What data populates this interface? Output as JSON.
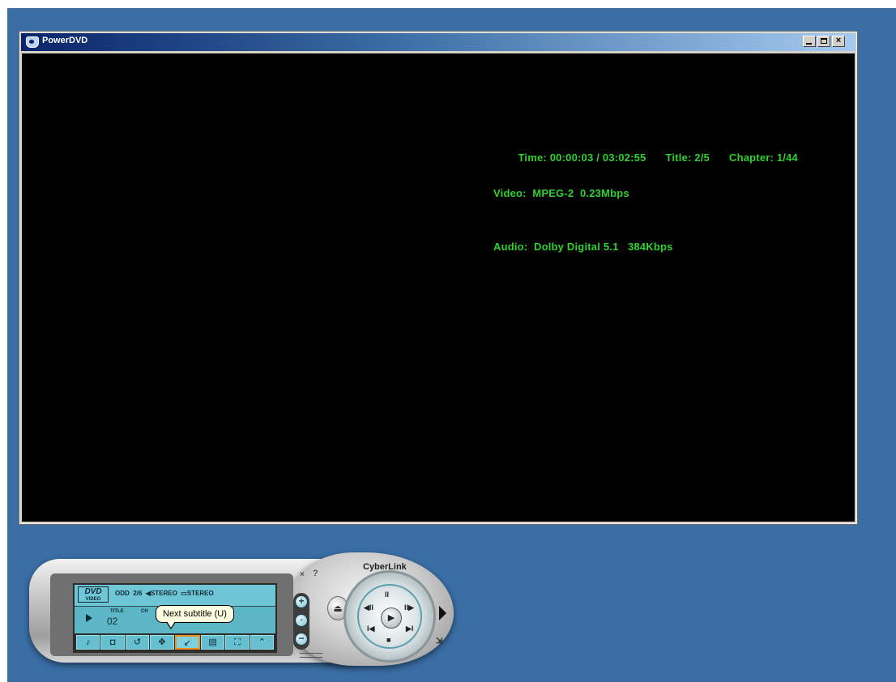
{
  "window": {
    "title": "PowerDVD",
    "controls": {
      "minimize": "_",
      "maximize": "□",
      "close": "×"
    }
  },
  "osd": {
    "time": "Time: 00:00:03 / 03:02:55",
    "title": "Title: 2/5",
    "chapter": "Chapter: 1/44",
    "video": "Video:  MPEG-2  0.23Mbps",
    "audio": "Audio:  Dolby Digital 5.1   384Kbps"
  },
  "remote": {
    "brand": "CyberLink",
    "close": "×",
    "help": "?",
    "lcd": {
      "logo": "DVD",
      "logo_sub": "VIDEO",
      "status": "ODD  2/6  ◀STEREO  ▭STEREO",
      "title_label": "TITLE",
      "title_number": "02",
      "chapter_label": "CH"
    },
    "function_buttons": [
      {
        "icon": "music-note-icon",
        "glyph": "♪"
      },
      {
        "icon": "camera-icon",
        "glyph": "◘"
      },
      {
        "icon": "repeat-icon",
        "glyph": "↺"
      },
      {
        "icon": "angle-icon",
        "glyph": "✥"
      },
      {
        "icon": "subtitle-icon",
        "glyph": "↙"
      },
      {
        "icon": "menu-icon",
        "glyph": "▤"
      },
      {
        "icon": "fullscreen-icon",
        "glyph": "⛶"
      },
      {
        "icon": "up-icon",
        "glyph": "⌃"
      }
    ],
    "volume": {
      "up": "+",
      "mute": "◦",
      "down": "−"
    },
    "eject": "⏏",
    "navigation": {
      "pause": "II",
      "prev": "◀II",
      "next": "II▶",
      "skip_back": "I◀",
      "skip_forward": "▶I",
      "stop": "■",
      "play": "▶"
    },
    "side_arrow": "▶"
  },
  "tooltip": {
    "text": "Next subtitle (U)"
  },
  "colors": {
    "desktop": "#3a6ea5",
    "osd_text": "#2fd12f",
    "lcd": "#5cb6c6",
    "highlight": "#f28c1e"
  }
}
